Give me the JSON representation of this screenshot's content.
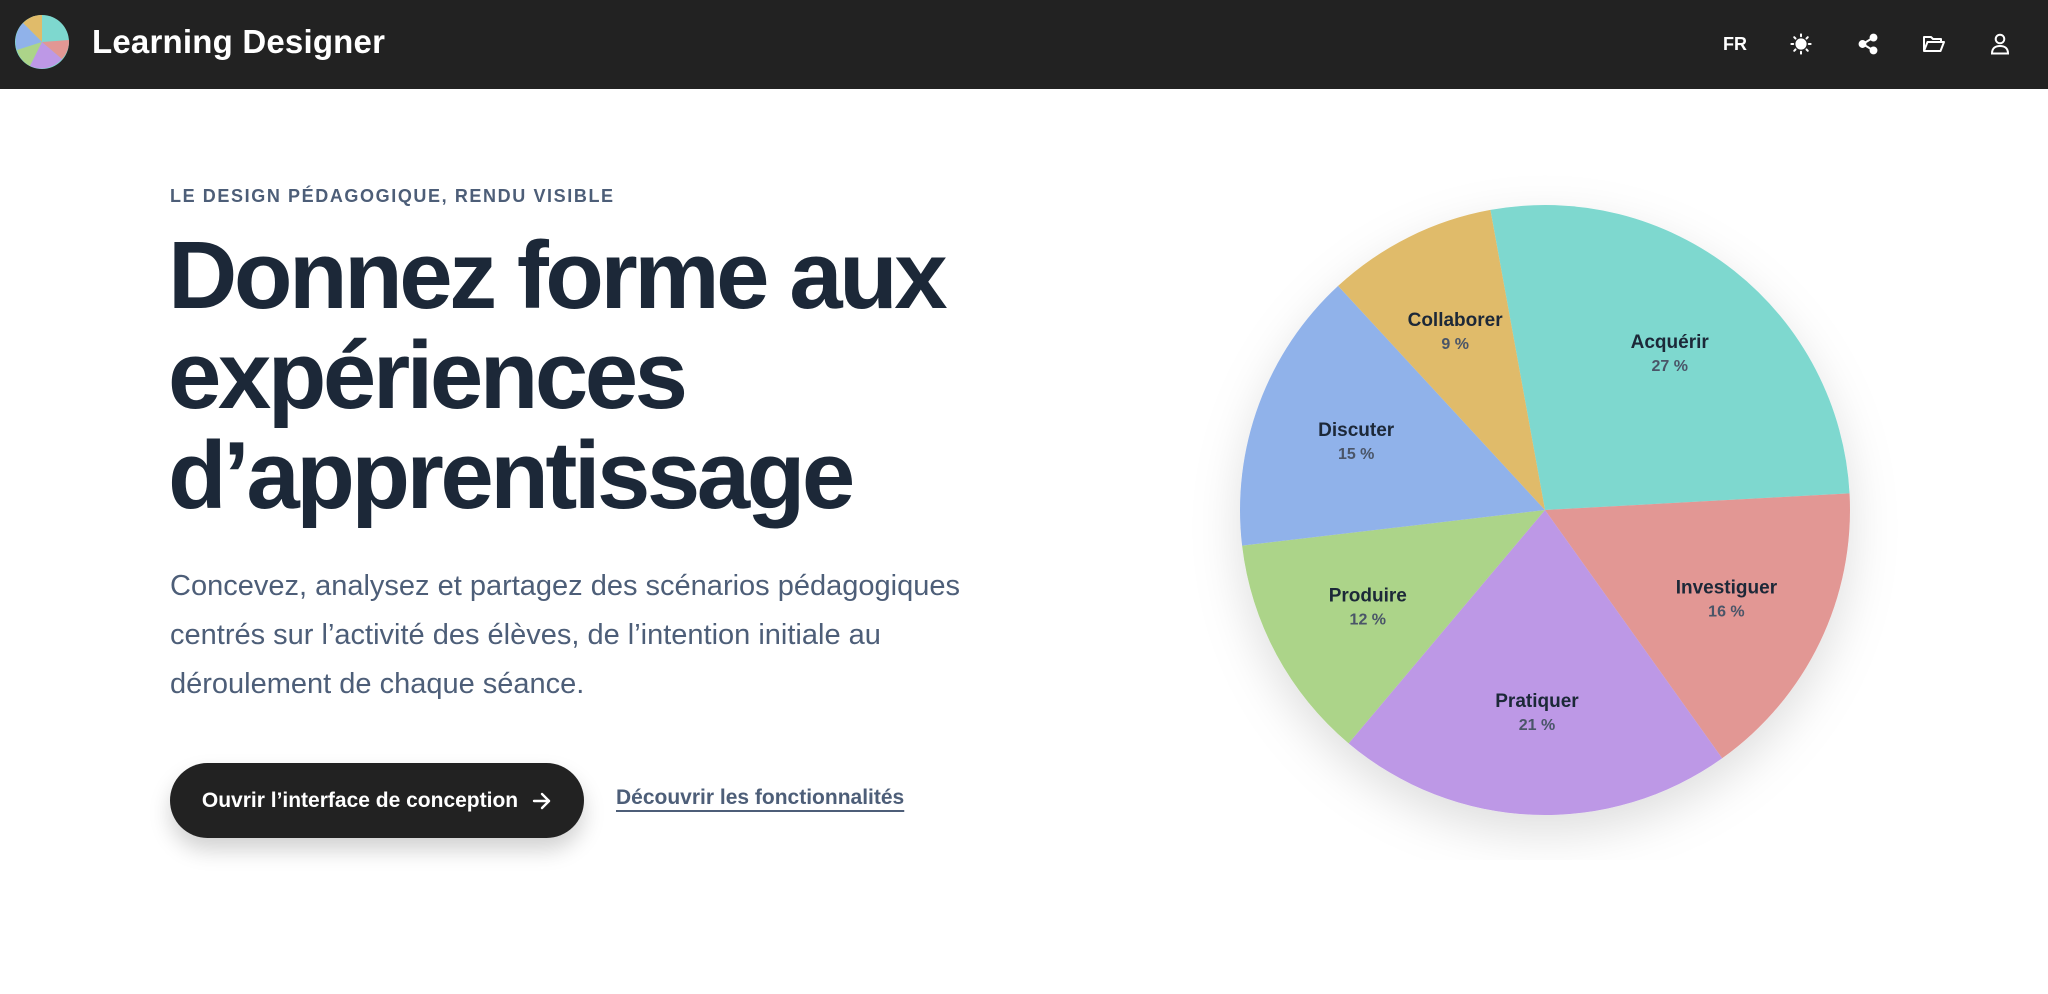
{
  "header": {
    "app_title": "Learning Designer",
    "logo_icon": "pie-logo-icon",
    "language": "FR",
    "icons": [
      "theme-toggle-icon",
      "share-icon",
      "folder-open-icon",
      "user-icon"
    ],
    "background": "#222222"
  },
  "hero": {
    "eyebrow": "LE DESIGN PÉDAGOGIQUE, RENDU VISIBLE",
    "title_lines": [
      "Donnez forme aux",
      "expériences",
      "d’apprentissage"
    ],
    "lead_lines": [
      "Concevez, analysez et partagez des scénarios pédagogiques",
      "centrés sur l’activité des élèves, de l’intention initiale au",
      "déroulement de chaque séance."
    ],
    "primary_cta": "Ouvrir l’interface de conception",
    "primary_cta_icon": "arrow-right-icon",
    "secondary_link": "Découvrir les fonctionnalités"
  },
  "chart_data": {
    "type": "pie",
    "slices": [
      {
        "label": "Acquérir",
        "value": 27,
        "display": "27 %",
        "color": "#7ed8cf"
      },
      {
        "label": "Investiguer",
        "value": 16,
        "display": "16 %",
        "color": "#e29794"
      },
      {
        "label": "Pratiquer",
        "value": 21,
        "display": "21 %",
        "color": "#bd98e6"
      },
      {
        "label": "Produire",
        "value": 12,
        "display": "12 %",
        "color": "#acd489"
      },
      {
        "label": "Discuter",
        "value": 15,
        "display": "15 %",
        "color": "#90b2ea"
      },
      {
        "label": "Collaborer",
        "value": 9,
        "display": "9 %",
        "color": "#e0bb6a"
      }
    ]
  }
}
